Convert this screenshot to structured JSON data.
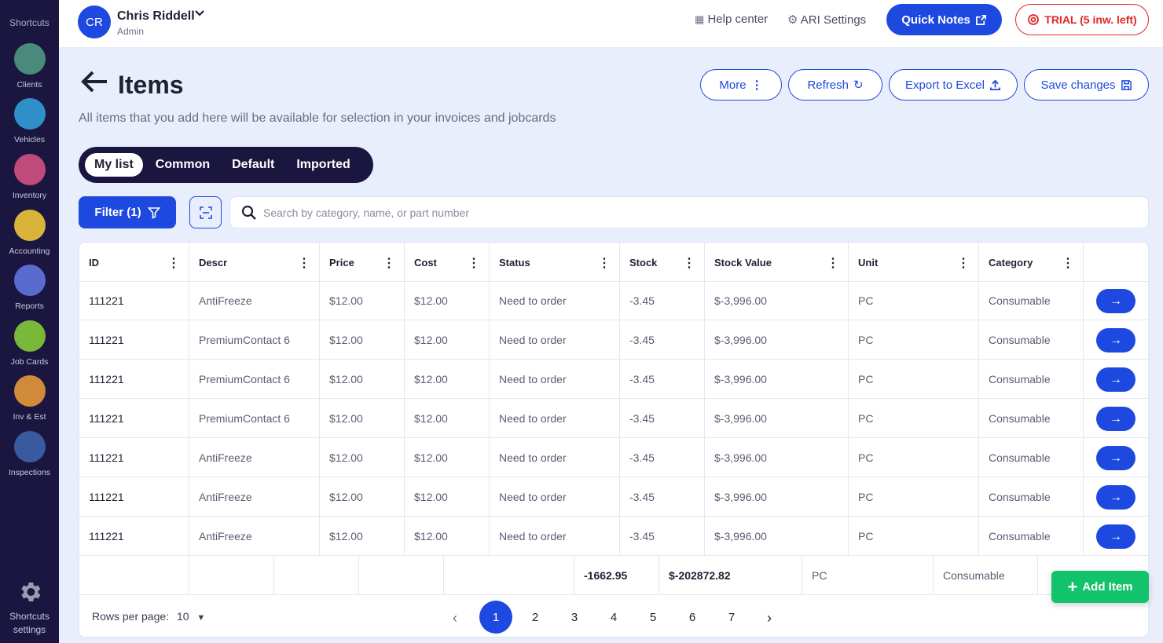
{
  "sidebar": {
    "heading": "Shortcuts",
    "items": [
      {
        "label": "Clients",
        "icon": "client-person-icon",
        "color": "#4a8a7a"
      },
      {
        "label": "Vehicles",
        "icon": "car-icon",
        "color": "#2f8fc9"
      },
      {
        "label": "Inventory",
        "icon": "binders-icon",
        "color": "#c04a7a"
      },
      {
        "label": "Accounting",
        "icon": "cash-icon",
        "color": "#d9b43a"
      },
      {
        "label": "Reports",
        "icon": "chart-icon",
        "color": "#5a6bd0"
      },
      {
        "label": "Job Cards",
        "icon": "clipboard-icon",
        "color": "#7ab83a"
      },
      {
        "label": "Inv & Est",
        "icon": "receipt-icon",
        "color": "#d08a3a"
      },
      {
        "label": "Inspections",
        "icon": "goggles-icon",
        "color": "#3a5aa0"
      }
    ],
    "settings_line1": "Shortcuts",
    "settings_line2": "settings"
  },
  "topbar": {
    "avatar_initials": "CR",
    "user_name": "Chris Riddell",
    "user_role": "Admin",
    "help_label": "Help center",
    "ari_label": "ARI Settings",
    "quick_notes_label": "Quick Notes",
    "trial_label": "TRIAL (5 inw. left)"
  },
  "page": {
    "title": "Items",
    "subtitle": "All items that you add here will be available for selection in your invoices and jobcards",
    "more_label": "More",
    "refresh_label": "Refresh",
    "export_label": "Export to Excel",
    "save_label": "Save changes"
  },
  "tabs": [
    "My list",
    "Common",
    "Default",
    "Imported"
  ],
  "active_tab": "My list",
  "filter_label": "Filter (1)",
  "search": {
    "placeholder": "Search by category, name, or part number",
    "value": ""
  },
  "table": {
    "columns": [
      "ID",
      "Descr",
      "Price",
      "Cost",
      "Status",
      "Stock",
      "Stock Value",
      "Unit",
      "Category"
    ],
    "rows": [
      [
        "111221",
        "AntiFreeze",
        "$12.00",
        "$12.00",
        "Need to order",
        "-3.45",
        "$-3,996.00",
        "PC",
        "Consumable"
      ],
      [
        "111221",
        "PremiumContact 6",
        "$12.00",
        "$12.00",
        "Need to order",
        "-3.45",
        "$-3,996.00",
        "PC",
        "Consumable"
      ],
      [
        "111221",
        "PremiumContact 6",
        "$12.00",
        "$12.00",
        "Need to order",
        "-3.45",
        "$-3,996.00",
        "PC",
        "Consumable"
      ],
      [
        "111221",
        "PremiumContact 6",
        "$12.00",
        "$12.00",
        "Need to order",
        "-3.45",
        "$-3,996.00",
        "PC",
        "Consumable"
      ],
      [
        "111221",
        "AntiFreeze",
        "$12.00",
        "$12.00",
        "Need to order",
        "-3.45",
        "$-3,996.00",
        "PC",
        "Consumable"
      ],
      [
        "111221",
        "AntiFreeze",
        "$12.00",
        "$12.00",
        "Need to order",
        "-3.45",
        "$-3,996.00",
        "PC",
        "Consumable"
      ],
      [
        "111221",
        "AntiFreeze",
        "$12.00",
        "$12.00",
        "Need to order",
        "-3.45",
        "$-3,996.00",
        "PC",
        "Consumable"
      ]
    ],
    "totals": {
      "stock": "-1662.95",
      "stock_value": "$-202872.82",
      "unit": "PC",
      "category": "Consumable"
    }
  },
  "pagination": {
    "rows_per_page_label": "Rows per page:",
    "rows_per_page_value": "10",
    "pages": [
      "1",
      "2",
      "3",
      "4",
      "5",
      "6",
      "7"
    ],
    "current": "1"
  },
  "add_item_label": "Add Item",
  "colors": {
    "primary": "#1e49e0",
    "sidebar": "#1b1640",
    "trial": "#e02626",
    "add": "#13c36b",
    "background": "#e9eefc"
  }
}
